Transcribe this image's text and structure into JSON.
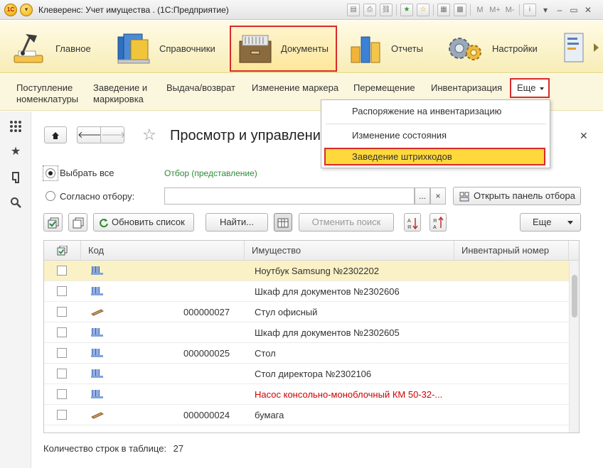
{
  "window": {
    "title": "Клеверенс: Учет имущества . (1С:Предприятие)",
    "logo_text": "1С",
    "toolbar_letters": [
      "M",
      "M+",
      "M-"
    ]
  },
  "sections": [
    {
      "label": "Главное",
      "icon": "desk-lamp-icon"
    },
    {
      "label": "Справочники",
      "icon": "books-icon"
    },
    {
      "label": "Документы",
      "icon": "file-cabinet-icon",
      "active": true
    },
    {
      "label": "Отчеты",
      "icon": "bar-chart-icon"
    },
    {
      "label": "Настройки",
      "icon": "gears-icon"
    }
  ],
  "commands": [
    {
      "label": "Поступление\nноменклатуры"
    },
    {
      "label": "Заведение и\nмаркировка"
    },
    {
      "label": "Выдача/возврат"
    },
    {
      "label": "Изменение маркера"
    },
    {
      "label": "Перемещение"
    },
    {
      "label": "Инвентаризация"
    }
  ],
  "more_label": "Еще",
  "dropdown": {
    "items": [
      {
        "label": "Распоряжение на инвентаризацию"
      },
      {
        "label": "Изменение состояния"
      },
      {
        "label": "Заведение штрихкодов",
        "highlighted": true
      }
    ]
  },
  "form": {
    "title": "Просмотр и управление",
    "radio_all": "Выбрать все",
    "radio_filter": "Согласно отбору:",
    "filter_link": "Отбор (представление)",
    "filter_value": "",
    "open_filter_panel": "Открыть панель отбора",
    "ellipsis": "...",
    "clear": "×",
    "refresh": "Обновить список",
    "find": "Найти...",
    "cancel_search": "Отменить поиск",
    "more": "Еще",
    "count_label": "Количество строк в таблице:",
    "count_value": "27"
  },
  "table": {
    "columns": [
      "Код",
      "Имущество",
      "Инвентарный номер"
    ],
    "rows": [
      {
        "code": "",
        "name": "Ноутбук Samsung №2302202",
        "inv": "",
        "icon": "barcode-item-icon",
        "selected": true,
        "red": false
      },
      {
        "code": "",
        "name": "Шкаф для документов №2302606",
        "inv": "",
        "icon": "barcode-item-icon",
        "red": false
      },
      {
        "code": "000000027",
        "name": "Стул офисный",
        "inv": "",
        "icon": "material-icon",
        "red": false
      },
      {
        "code": "",
        "name": "Шкаф для документов №2302605",
        "inv": "",
        "icon": "barcode-item-icon",
        "red": false
      },
      {
        "code": "000000025",
        "name": "Стол",
        "inv": "",
        "icon": "barcode-item-icon",
        "red": false
      },
      {
        "code": "",
        "name": "Стол директора №2302106",
        "inv": "",
        "icon": "barcode-item-icon",
        "red": false
      },
      {
        "code": "",
        "name": "Насос консольно-моноблочный КМ 50-32-...",
        "inv": "",
        "icon": "barcode-item-icon",
        "red": true
      },
      {
        "code": "000000024",
        "name": "бумага",
        "inv": "",
        "icon": "material-icon",
        "red": false
      }
    ]
  },
  "colors": {
    "accent_red": "#d82a2a",
    "highlight_yellow": "#ffd83b",
    "link_green": "#2d8a3a",
    "sections_bg": "#f7edb6"
  }
}
